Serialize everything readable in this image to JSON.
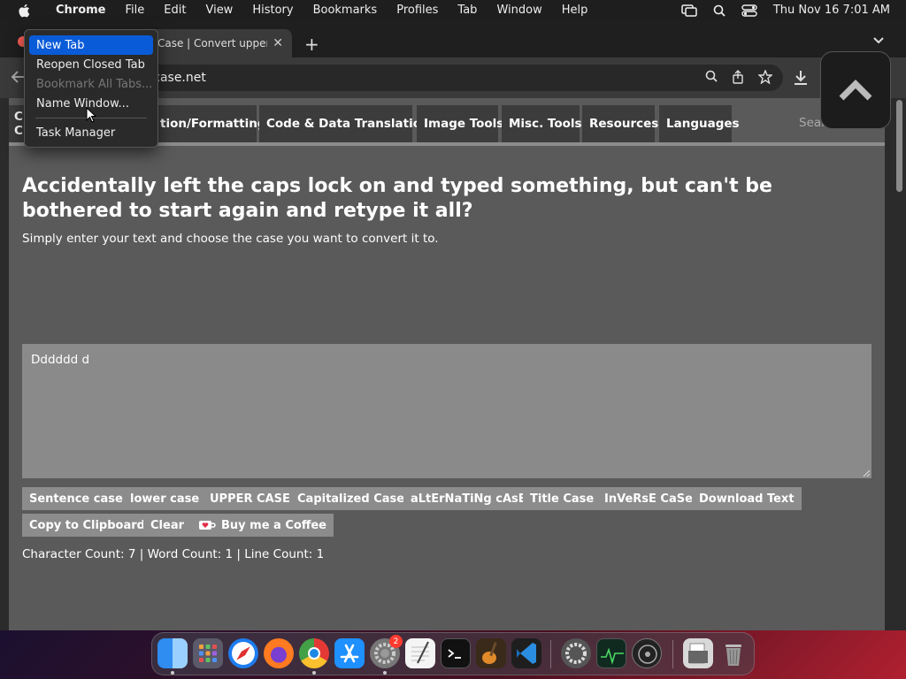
{
  "menubar": {
    "app": "Chrome",
    "items": [
      "File",
      "Edit",
      "View",
      "History",
      "Bookmarks",
      "Profiles",
      "Tab",
      "Window",
      "Help"
    ],
    "datetime": "Thu Nov 16  7:01 AM"
  },
  "browser": {
    "tab_title": "Case | Convert upper",
    "url": "rtcase.net"
  },
  "context_menu": {
    "items": [
      "New Tab",
      "Reopen Closed Tab",
      "Bookmark All Tabs...",
      "Name Window...",
      "Task Manager"
    ]
  },
  "nav": {
    "left_partial": [
      "C",
      "C"
    ],
    "items": [
      "tion/Formatting",
      "Code & Data Translation",
      "Image Tools",
      "Misc. Tools",
      "Resources",
      "Languages"
    ],
    "search_stub": "Sear"
  },
  "main": {
    "headline": "Accidentally left the caps lock on and typed something, but can't be bothered to start again and retype it all?",
    "subhead": "Simply enter your text and choose the case you want to convert it to.",
    "textarea_value": "Dddddd d"
  },
  "buttons": {
    "row1": [
      "Sentence case",
      "lower case",
      "UPPER CASE",
      "Capitalized Case",
      "aLtErNaTiNg cAsE",
      "Title Case",
      "InVeRsE CaSe",
      "Download Text"
    ],
    "row2": [
      "Copy to Clipboard",
      "Clear",
      "Buy me a Coffee"
    ]
  },
  "counts": "Character Count: 7 | Word Count: 1 | Line Count: 1",
  "dock": {
    "badge": "2"
  },
  "colors": {
    "selection": "#0a5bd8",
    "page_bg": "#5a5a5a",
    "nav_bg": "#3c3c3c",
    "button_bg": "#8c8c8c"
  }
}
